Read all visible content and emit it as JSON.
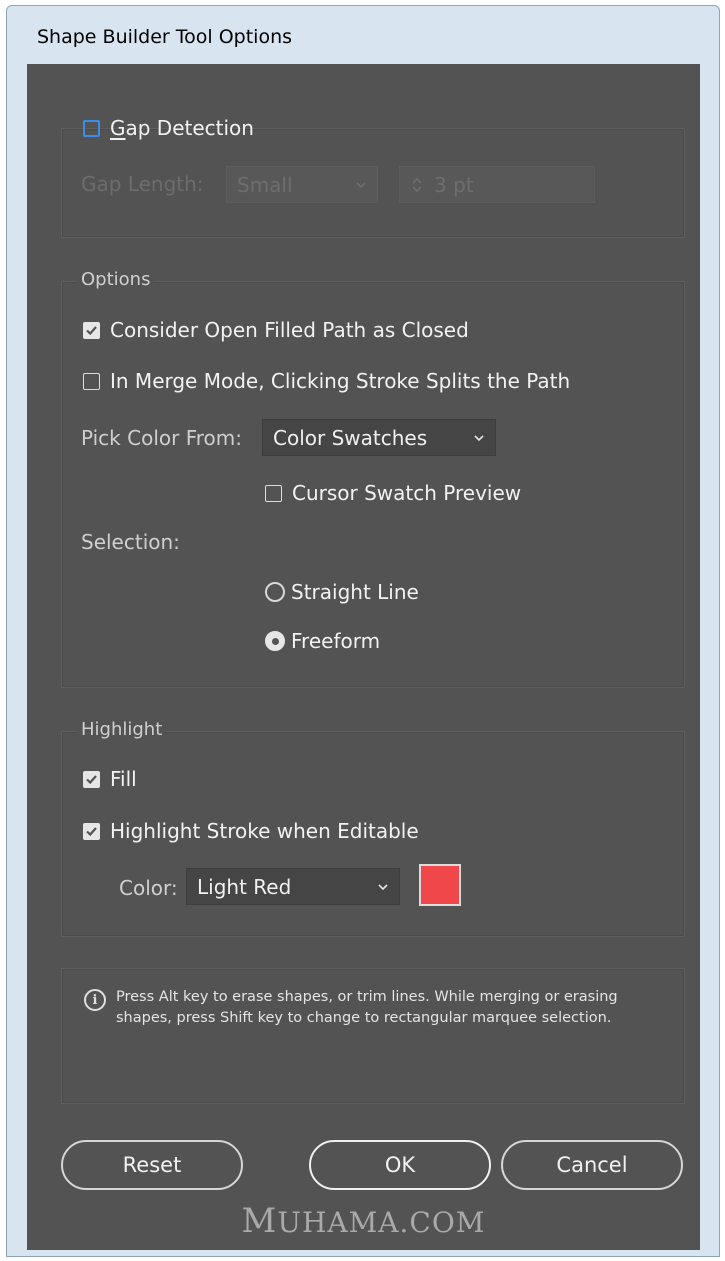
{
  "window": {
    "title": "Shape Builder Tool Options"
  },
  "gap_detection": {
    "checkbox_label": "Gap Detection",
    "checked": false,
    "gap_length_label": "Gap Length:",
    "gap_length_value": "Small",
    "gap_value": "3 pt"
  },
  "options": {
    "legend": "Options",
    "consider_open_filled": {
      "label": "Consider Open Filled Path as Closed",
      "checked": true
    },
    "merge_mode_split": {
      "label": "In Merge Mode, Clicking Stroke Splits the Path",
      "checked": false
    },
    "pick_color_label": "Pick Color From:",
    "pick_color_value": "Color Swatches",
    "cursor_preview": {
      "label": "Cursor Swatch Preview",
      "checked": false
    },
    "selection_label": "Selection:",
    "straight_line": {
      "label": "Straight Line",
      "selected": false
    },
    "freeform": {
      "label": "Freeform",
      "selected": true
    }
  },
  "highlight": {
    "legend": "Highlight",
    "fill": {
      "label": "Fill",
      "checked": true
    },
    "stroke_editable": {
      "label": "Highlight Stroke when Editable",
      "checked": true
    },
    "color_label": "Color:",
    "color_value": "Light Red",
    "swatch_color": "#f0484a"
  },
  "info": {
    "icon": "info-icon",
    "text": "Press Alt key to erase shapes, or trim lines. While merging or erasing shapes, press Shift key to change to rectangular marquee selection."
  },
  "buttons": {
    "reset": "Reset",
    "ok": "OK",
    "cancel": "Cancel"
  },
  "watermark": {
    "first": "M",
    "rest": "UHAMA.COM"
  },
  "colors": {
    "panel": "#535353",
    "accent_checkbox": "#3a8ee6"
  }
}
